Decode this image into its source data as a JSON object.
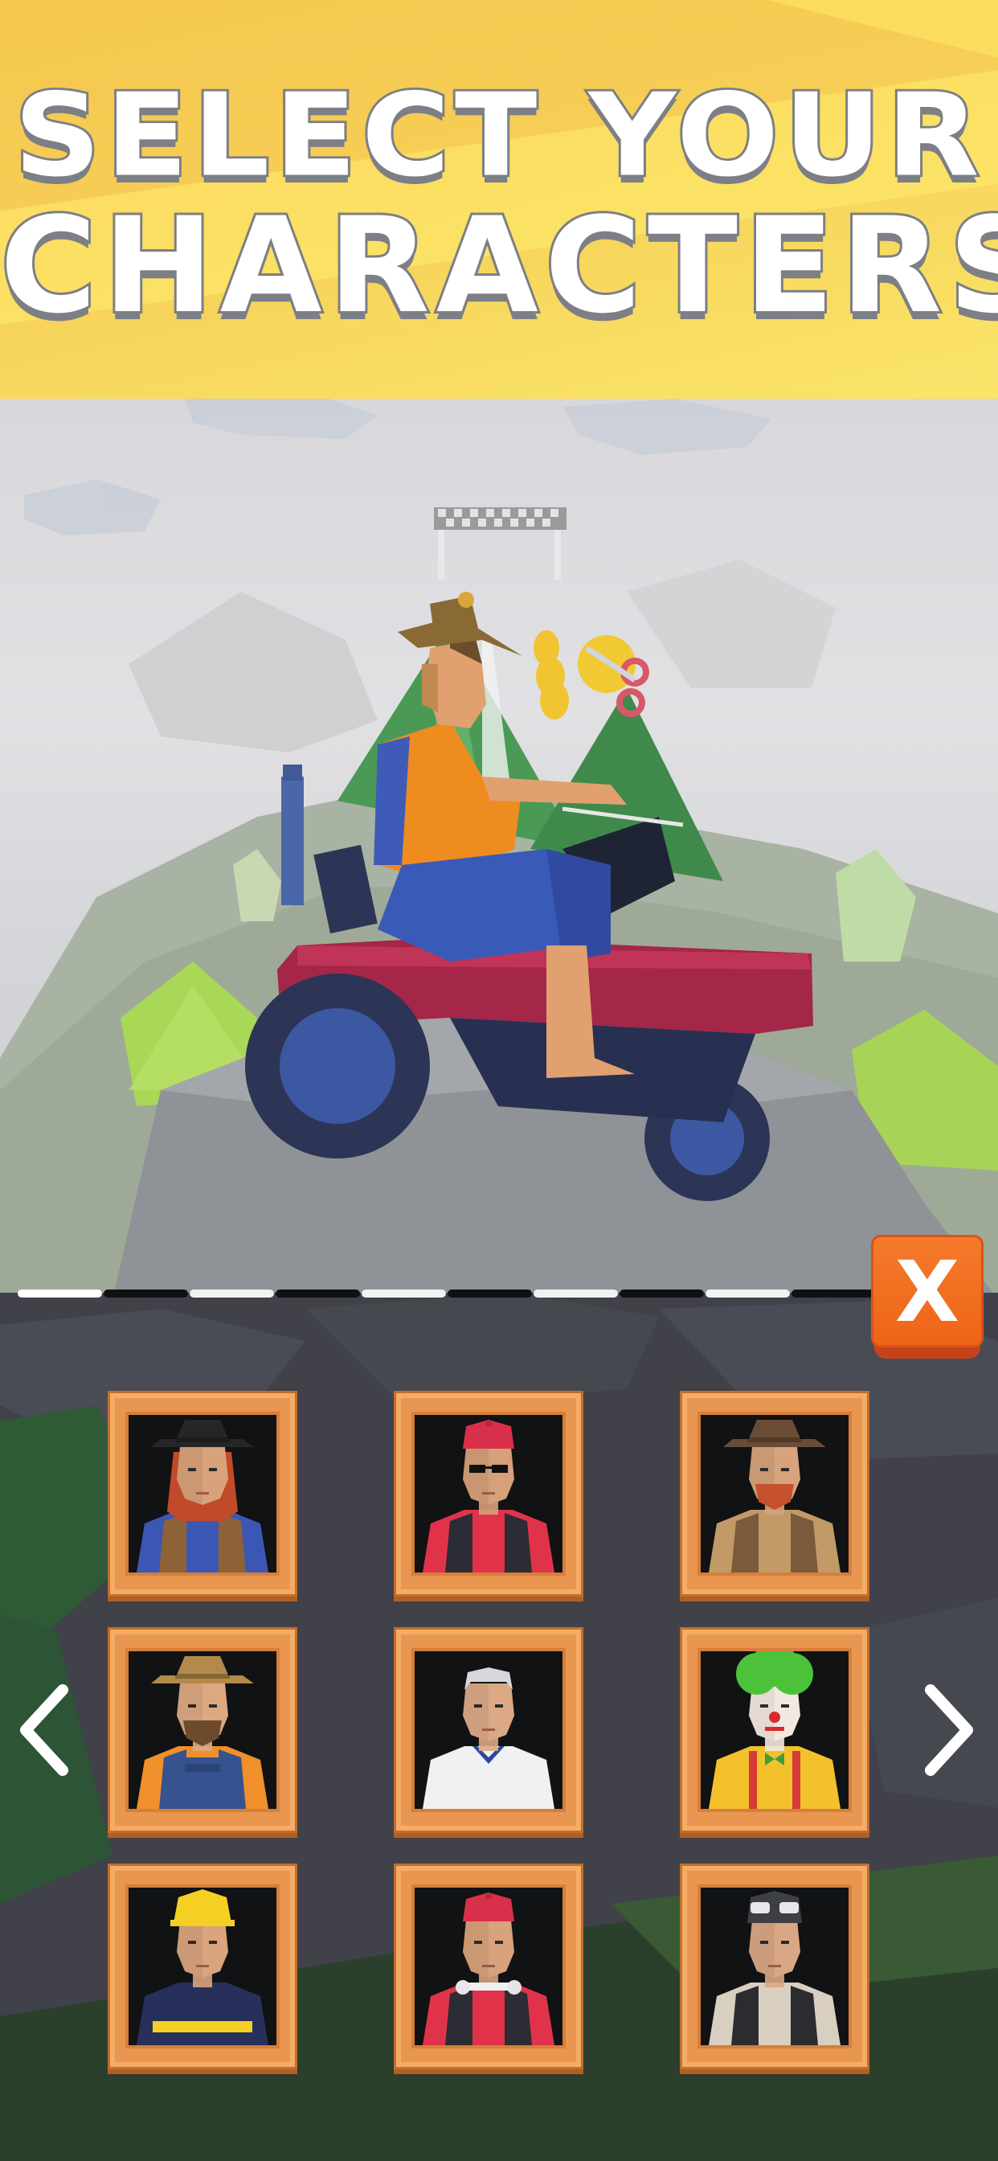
{
  "header": {
    "line1": "SELECT YOUR",
    "line2": "CHARACTERS!"
  },
  "close_button": {
    "label": "X"
  },
  "progress": {
    "segments_total": 10,
    "segments_filled": 1
  },
  "characters": [
    {
      "id": "cowgirl",
      "selected": false
    },
    {
      "id": "biker-red-cap-sunglasses",
      "selected": false
    },
    {
      "id": "cowboy-red-beard",
      "selected": false
    },
    {
      "id": "farmer-overalls",
      "selected": true
    },
    {
      "id": "old-man-white-shirt",
      "selected": false
    },
    {
      "id": "clown",
      "selected": false
    },
    {
      "id": "firefighter",
      "selected": false
    },
    {
      "id": "rider-red-helmet",
      "selected": false
    },
    {
      "id": "aviator-goggles",
      "selected": false
    }
  ],
  "navigation": {
    "prev_icon": "chevron-left-icon",
    "next_icon": "chevron-right-icon"
  },
  "colors": {
    "banner": "#f6cd55",
    "accent_orange": "#ee6417",
    "card_frame": "#e89650",
    "panel": "#404149"
  }
}
